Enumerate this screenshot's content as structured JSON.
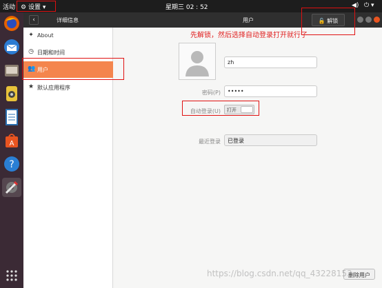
{
  "topbar": {
    "activities": "活动",
    "app_menu": "设置",
    "clock": "星期三 02 : 52"
  },
  "header": {
    "section_title": "详细信息",
    "page_title": "用户",
    "unlock_label": "解锁"
  },
  "sidebar": {
    "items": [
      {
        "label": "About",
        "icon": "plus-icon"
      },
      {
        "label": "日期和时间",
        "icon": "clock-icon"
      },
      {
        "label": "用户",
        "icon": "users-icon"
      },
      {
        "label": "默认应用程序",
        "icon": "star-icon"
      }
    ]
  },
  "user": {
    "name": "zh",
    "password_label": "密码(P)",
    "password_value": "•••••",
    "autologin_label": "自动登录(U)",
    "autologin_state": "打开",
    "last_login_label": "最近登录",
    "last_login_value": "已登录",
    "remove_user": "删除用户"
  },
  "annotation": {
    "note": "先解锁，然后选择自动登录打开就行了"
  },
  "watermark": "https://blog.csdn.net/qq_43228153",
  "colors": {
    "accent": "#f4854d",
    "annotation_red": "#e01010"
  }
}
